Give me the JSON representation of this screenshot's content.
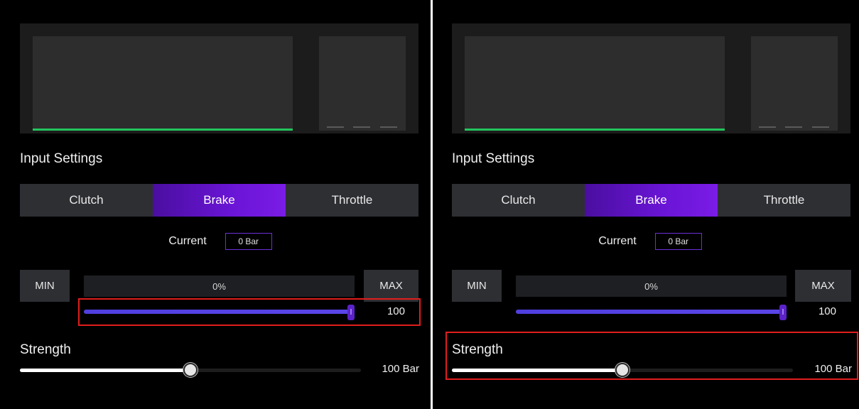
{
  "colors": {
    "accent": "#6a15d6",
    "graph_line": "#22c55e",
    "highlight": "#e11d1d",
    "panel_bg": "#000000"
  },
  "panels": [
    {
      "section_title": "Input Settings",
      "tabs": [
        {
          "label": "Clutch",
          "active": false
        },
        {
          "label": "Brake",
          "active": true
        },
        {
          "label": "Throttle",
          "active": false
        }
      ],
      "current": {
        "label": "Current",
        "value": "0 Bar"
      },
      "min_label": "MIN",
      "max_label": "MAX",
      "percent_text": "0%",
      "range_slider": {
        "value": 100,
        "value_text": "100"
      },
      "strength": {
        "label": "Strength",
        "fraction": 0.5,
        "value_text": "100 Bar"
      },
      "highlighted_region": "range-slider"
    },
    {
      "section_title": "Input Settings",
      "tabs": [
        {
          "label": "Clutch",
          "active": false
        },
        {
          "label": "Brake",
          "active": true
        },
        {
          "label": "Throttle",
          "active": false
        }
      ],
      "current": {
        "label": "Current",
        "value": "0 Bar"
      },
      "min_label": "MIN",
      "max_label": "MAX",
      "percent_text": "0%",
      "range_slider": {
        "value": 100,
        "value_text": "100"
      },
      "strength": {
        "label": "Strength",
        "fraction": 0.5,
        "value_text": "100 Bar"
      },
      "highlighted_region": "strength-slider"
    }
  ]
}
